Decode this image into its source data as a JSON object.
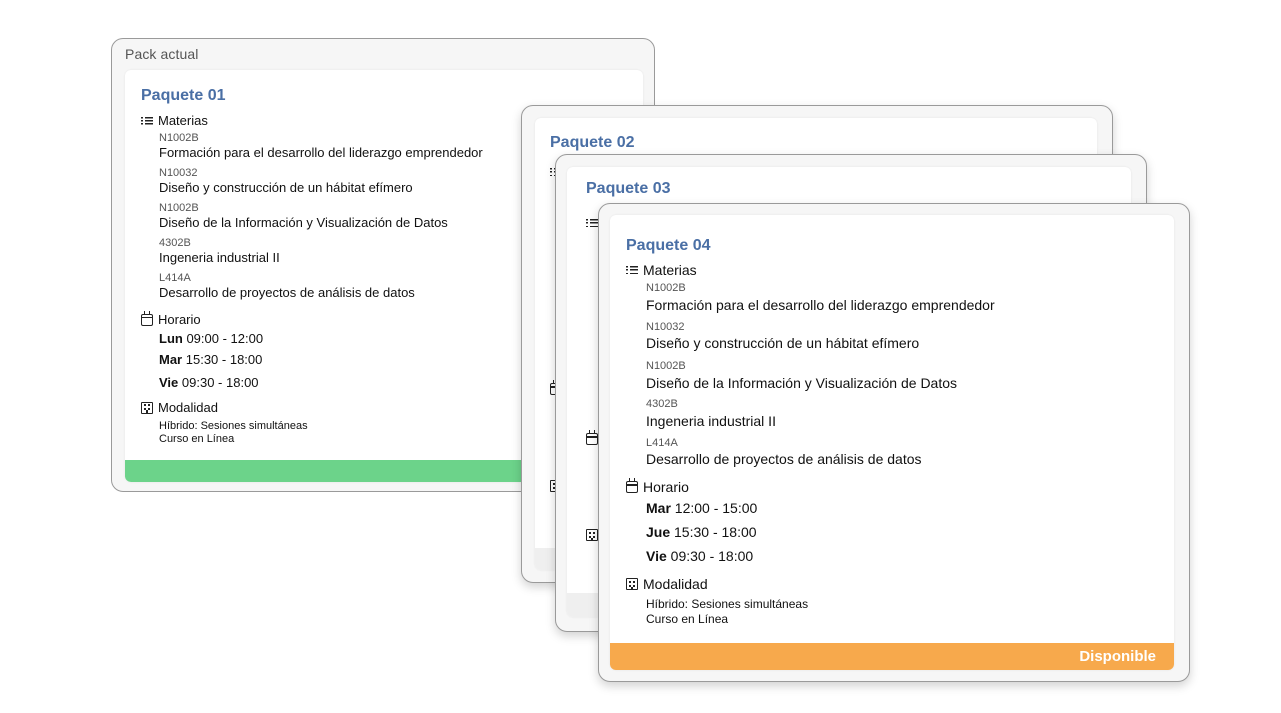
{
  "current_pack": {
    "frame_title": "Pack actual",
    "title": "Paquete 01",
    "materias_label": "Materias",
    "subjects": [
      {
        "code": "N1002B",
        "name": "Formación para el desarrollo del liderazgo emprendedor"
      },
      {
        "code": "N10032",
        "name": "Diseño y construcción de un hábitat efímero"
      },
      {
        "code": "N1002B",
        "name": "Diseño de la Información y Visualización de Datos"
      },
      {
        "code": "4302B",
        "name": "Ingeneria industrial II"
      },
      {
        "code": "L414A",
        "name": "Desarrollo de proyectos de análisis de datos"
      }
    ],
    "horario_label": "Horario",
    "schedule": [
      {
        "day": "Lun",
        "time": "09:00 - 12:00"
      },
      {
        "day": "Mar",
        "time": "15:30 - 18:00"
      },
      {
        "day": "Vie",
        "time": "09:30 - 18:00"
      }
    ],
    "modalidad_label": "Modalidad",
    "modes": [
      "Híbrido: Sesiones simultáneas",
      "Curso en Línea"
    ],
    "status_color": "#6cd38a"
  },
  "package_02": {
    "title": "Paquete 02"
  },
  "package_03": {
    "title": "Paquete 03"
  },
  "package_04": {
    "title": "Paquete 04",
    "materias_label": "Materias",
    "subjects": [
      {
        "code": "N1002B",
        "name": "Formación para el desarrollo del liderazgo emprendedor"
      },
      {
        "code": "N10032",
        "name": "Diseño y construcción de un hábitat efímero"
      },
      {
        "code": "N1002B",
        "name": "Diseño de la Información y Visualización de Datos"
      },
      {
        "code": "4302B",
        "name": "Ingeneria industrial II"
      },
      {
        "code": "L414A",
        "name": "Desarrollo de proyectos de análisis de datos"
      }
    ],
    "horario_label": "Horario",
    "schedule": [
      {
        "day": "Mar",
        "time": "12:00 - 15:00"
      },
      {
        "day": "Jue",
        "time": "15:30 - 18:00"
      },
      {
        "day": "Vie",
        "time": "09:30 - 18:00"
      }
    ],
    "modalidad_label": "Modalidad",
    "modes": [
      "Híbrido: Sesiones simultáneas",
      "Curso en Línea"
    ],
    "status_label": "Disponible",
    "status_color": "#f7a94c"
  },
  "icons": {
    "materias": "list-icon",
    "horario": "calendar-icon",
    "modalidad": "building-icon"
  }
}
